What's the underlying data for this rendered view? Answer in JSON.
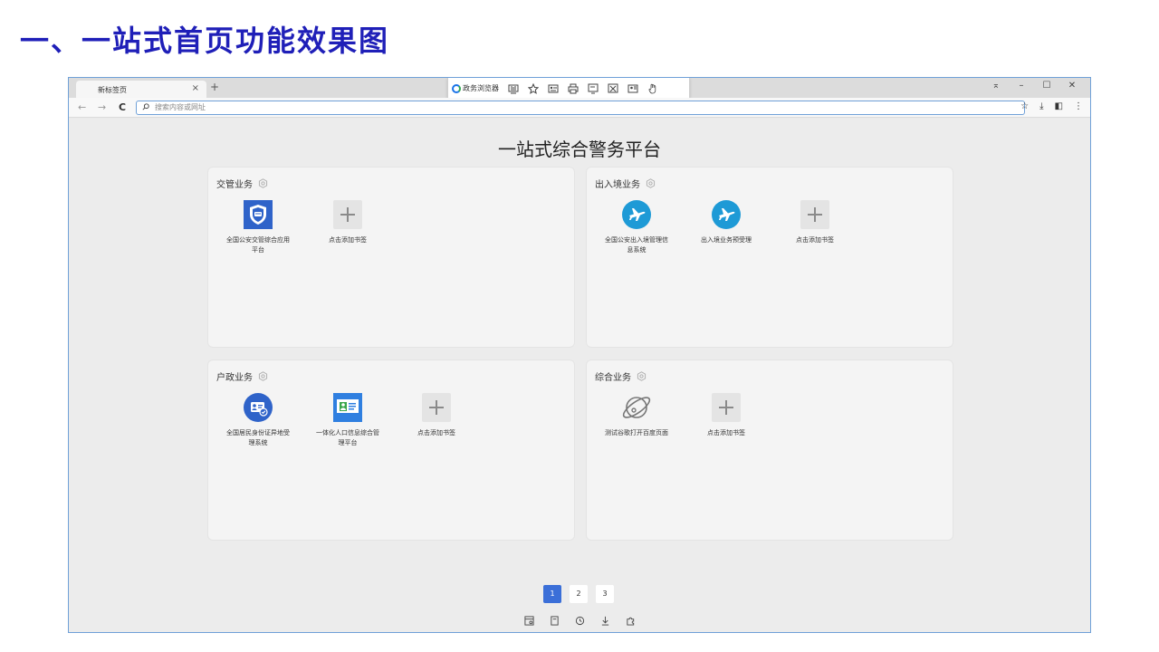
{
  "slide": {
    "title": "一、一站式首页功能效果图"
  },
  "browser": {
    "tab_title": "新标签页",
    "tab_close": "×",
    "tab_new": "+",
    "brand_name": "政务浏览器",
    "toolbar_icons": [
      "chart-icon",
      "star-icon",
      "id-card-icon",
      "print-icon",
      "screen-icon",
      "close-box-icon",
      "profile-icon",
      "hand-icon"
    ],
    "window_controls": {
      "pin": "⌅",
      "minimize": "–",
      "maximize": "☐",
      "close": "✕"
    },
    "nav": {
      "back": "←",
      "forward": "→",
      "reload": "C"
    },
    "url_placeholder": "搜索内容或网址",
    "addr_icons": {
      "favorite": "☆",
      "download": "⤓",
      "sidebar": "◧",
      "menu": "⋮"
    },
    "accent_color": "#3b6fd8"
  },
  "page": {
    "title": "一站式综合警务平台",
    "cards": [
      {
        "title": "交管业务",
        "apps": [
          {
            "label": "全国公安交管综合应用平台",
            "icon": "traffic-shield-icon"
          },
          {
            "label": "点击添加书签",
            "icon": "plus-icon"
          }
        ]
      },
      {
        "title": "出入境业务",
        "apps": [
          {
            "label": "全国公安出入境管理信息系统",
            "icon": "airplane-icon"
          },
          {
            "label": "出入境业务预受理",
            "icon": "airplane-icon"
          },
          {
            "label": "点击添加书签",
            "icon": "plus-icon"
          }
        ]
      },
      {
        "title": "户政业务",
        "apps": [
          {
            "label": "全国居民身份证异地受理系统",
            "icon": "id-badge-icon"
          },
          {
            "label": "一体化人口信息综合管理平台",
            "icon": "population-card-icon"
          },
          {
            "label": "点击添加书签",
            "icon": "plus-icon"
          }
        ]
      },
      {
        "title": "综合业务",
        "apps": [
          {
            "label": "测试谷歌打开百度页面",
            "icon": "planet-icon"
          },
          {
            "label": "点击添加书签",
            "icon": "plus-icon"
          }
        ]
      }
    ],
    "pagination": [
      "1",
      "2",
      "3"
    ],
    "active_page": "1",
    "bottom_icons": [
      "window-icon",
      "copy-icon",
      "history-icon",
      "download-icon",
      "extension-icon"
    ]
  }
}
